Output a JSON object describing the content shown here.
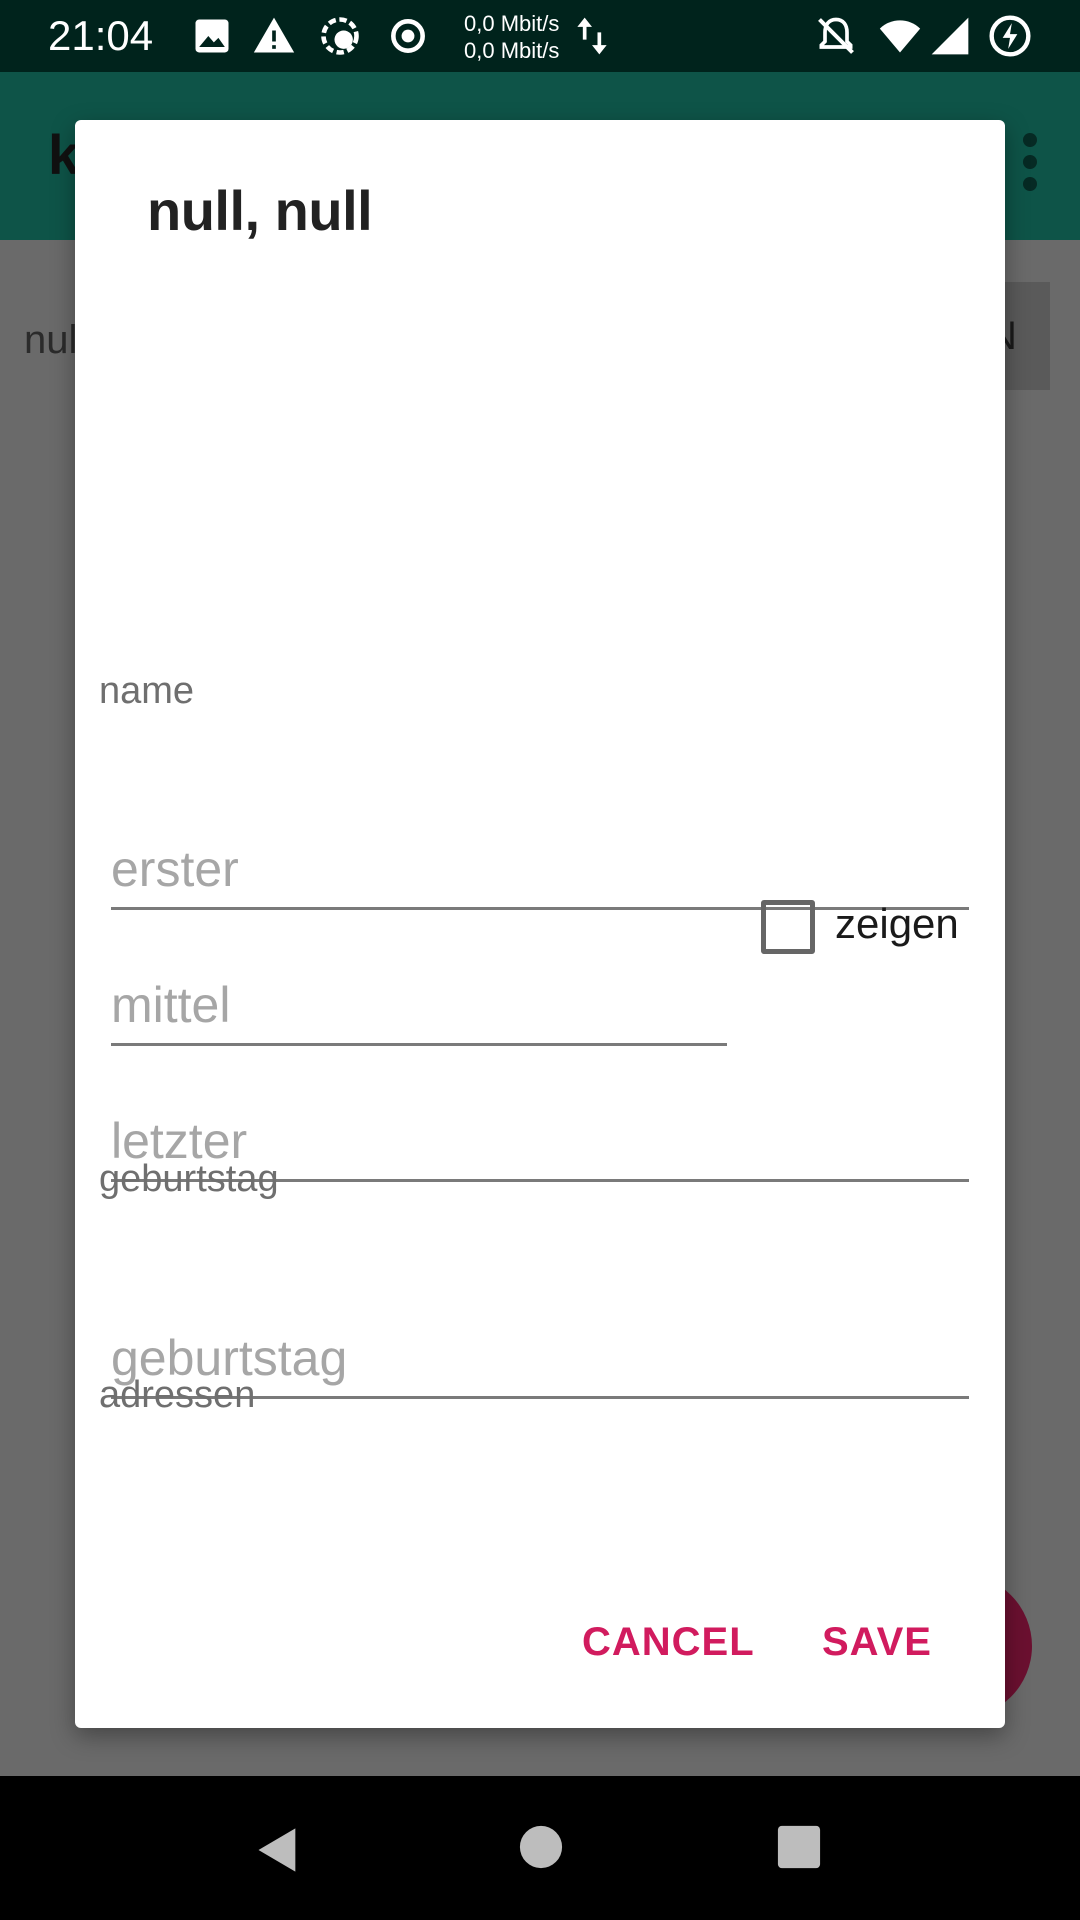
{
  "status_bar": {
    "time": "21:04",
    "net_upload": "0,0 Mbit/s",
    "net_download": "0,0 Mbit/s",
    "icons": [
      "image-icon",
      "warning-icon",
      "sync-icon",
      "record-icon",
      "data-arrows-icon",
      "muted-bell-icon",
      "wifi-icon",
      "signal-icon",
      "battery-charging-icon"
    ]
  },
  "background": {
    "app_title": "k",
    "row_text": "nul",
    "row_button": "N"
  },
  "dialog": {
    "title": "null, null",
    "name_label": "name",
    "first_placeholder": "erster",
    "middle_placeholder": "mittel",
    "show_checkbox_label": "zeigen",
    "last_placeholder": "letzter",
    "birthday_label": "geburtstag",
    "birthday_placeholder": "geburtstag",
    "addresses_label": "adressen",
    "cancel_label": "CANCEL",
    "save_label": "SAVE"
  },
  "colors": {
    "accent": "#d11b5e",
    "app_bar": "#0e5448",
    "status_bar": "#00231c"
  }
}
